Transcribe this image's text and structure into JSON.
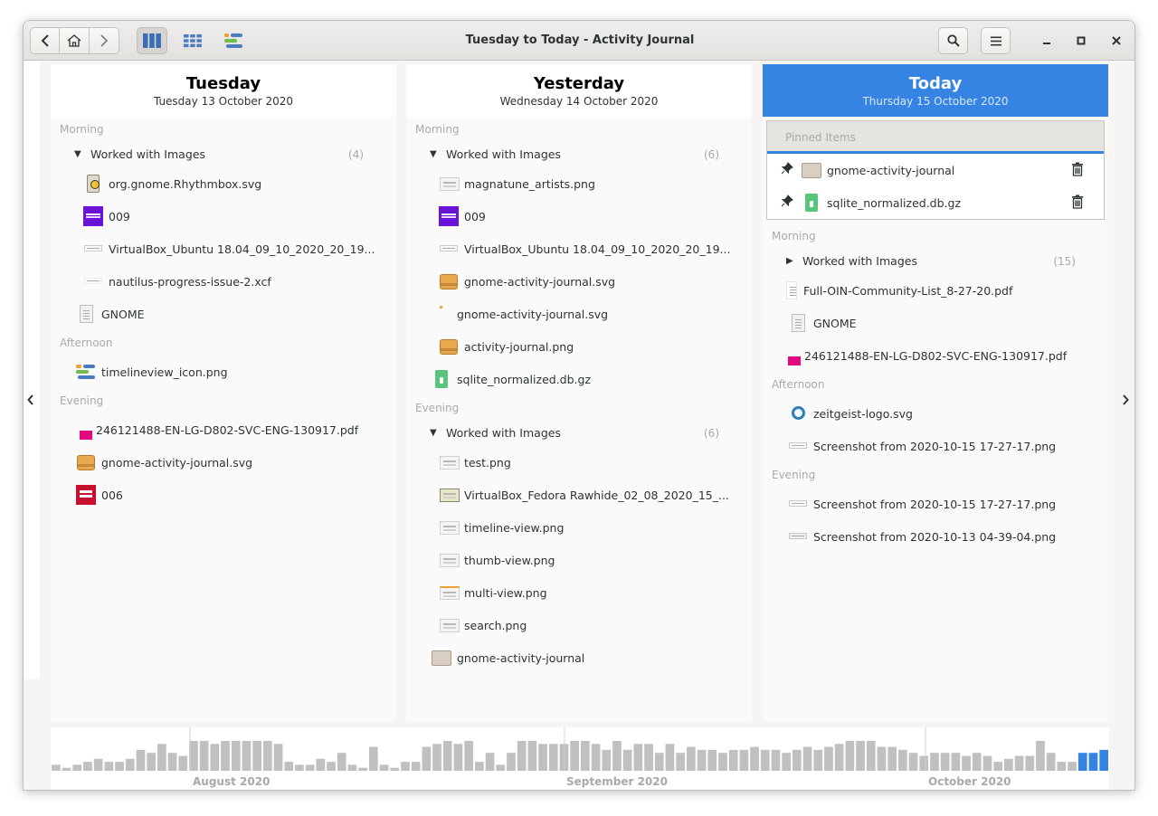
{
  "window": {
    "title": "Tuesday to Today - Activity Journal",
    "controls": {
      "minimize": "–",
      "maximize": "□",
      "close": "✕"
    }
  },
  "toolbar": {
    "back_icon": "chevron-left-icon",
    "home_icon": "home-icon",
    "forward_icon": "chevron-right-icon",
    "search_icon": "search-icon",
    "menu_icon": "hamburger-menu-icon",
    "accent": "#3584e4"
  },
  "columns": [
    {
      "day": "Tuesday",
      "date": "Tuesday 13 October 2020",
      "sections": [
        {
          "label": "Morning",
          "group": {
            "label": "Worked with Images",
            "count": "(4)"
          },
          "items": [
            {
              "label": "org.gnome.Rhythmbox.svg",
              "icon": "rhythmbox-icon"
            },
            {
              "label": "009",
              "icon": "purple-thumbnail-icon"
            },
            {
              "label": "VirtualBox_Ubuntu 18.04_09_10_2020_20_19...",
              "icon": "screenshot-icon"
            },
            {
              "label": "nautilus-progress-issue-2.xcf",
              "icon": "xcf-icon"
            }
          ],
          "after": [
            {
              "label": "GNOME",
              "icon": "document-icon"
            }
          ]
        },
        {
          "label": "Afternoon",
          "items": [
            {
              "label": "timelineview_icon.png",
              "icon": "timeline-icon"
            }
          ]
        },
        {
          "label": "Evening",
          "items": [
            {
              "label": "246121488-EN-LG-D802-SVC-ENG-130917.pdf",
              "icon": "pdf-icon"
            },
            {
              "label": "gnome-activity-journal.svg",
              "icon": "package-icon"
            },
            {
              "label": "006",
              "icon": "red-thumbnail-icon"
            }
          ]
        }
      ]
    },
    {
      "day": "Yesterday",
      "date": "Wednesday 14 October 2020",
      "sections": [
        {
          "label": "Morning",
          "group": {
            "label": "Worked with Images",
            "count": "(6)"
          },
          "items": [
            {
              "label": "magnatune_artists.png",
              "icon": "screenshot-icon"
            },
            {
              "label": "009",
              "icon": "purple-thumbnail-icon"
            },
            {
              "label": "VirtualBox_Ubuntu 18.04_09_10_2020_20_19...",
              "icon": "screenshot-icon"
            },
            {
              "label": "gnome-activity-journal.svg",
              "icon": "package-icon"
            },
            {
              "label": "gnome-activity-journal.svg",
              "icon": "small-dot-icon"
            },
            {
              "label": "activity-journal.png",
              "icon": "package-icon"
            }
          ],
          "after": [
            {
              "label": "sqlite_normalized.db.gz",
              "icon": "archive-icon"
            }
          ]
        },
        {
          "label": "Evening",
          "group": {
            "label": "Worked with Images",
            "count": "(6)"
          },
          "items": [
            {
              "label": "test.png",
              "icon": "screenshot-icon"
            },
            {
              "label": "VirtualBox_Fedora Rawhide_02_08_2020_15_...",
              "icon": "screenshot-icon"
            },
            {
              "label": "timeline-view.png",
              "icon": "screenshot-icon"
            },
            {
              "label": "thumb-view.png",
              "icon": "screenshot-icon"
            },
            {
              "label": "multi-view.png",
              "icon": "screenshot-icon"
            },
            {
              "label": "search.png",
              "icon": "screenshot-icon"
            }
          ],
          "after": [
            {
              "label": "gnome-activity-journal",
              "icon": "folder-icon"
            }
          ]
        }
      ]
    },
    {
      "day": "Today",
      "date": "Thursday 15 October 2020",
      "pinned": {
        "label": "Pinned Items",
        "items": [
          {
            "label": "gnome-activity-journal",
            "icon": "folder-icon"
          },
          {
            "label": "sqlite_normalized.db.gz",
            "icon": "archive-icon"
          }
        ]
      },
      "sections": [
        {
          "label": "Morning",
          "group": {
            "label": "Worked with Images",
            "count": "(15)",
            "collapsed": true
          },
          "items": [],
          "after": [
            {
              "label": "Full-OIN-Community-List_8-27-20.pdf",
              "icon": "pdf-doc-icon"
            },
            {
              "label": "GNOME",
              "icon": "document-icon"
            },
            {
              "label": "246121488-EN-LG-D802-SVC-ENG-130917.pdf",
              "icon": "pdf-icon"
            }
          ]
        },
        {
          "label": "Afternoon",
          "items": [
            {
              "label": "zeitgeist-logo.svg",
              "icon": "zeitgeist-icon"
            },
            {
              "label": "Screenshot from 2020-10-15 17-27-17.png",
              "icon": "screenshot-icon"
            }
          ]
        },
        {
          "label": "Evening",
          "items": [
            {
              "label": "Screenshot from 2020-10-15 17-27-17.png",
              "icon": "screenshot-icon"
            },
            {
              "label": "Screenshot from 2020-10-13 04-39-04.png",
              "icon": "screenshot-icon"
            }
          ]
        }
      ]
    }
  ],
  "timeline": {
    "months": [
      "August 2020",
      "September 2020",
      "October 2020"
    ],
    "bar_color": "#c0c0c0",
    "selected_color": "#3584e4",
    "activity": [
      2,
      1,
      2,
      3,
      4,
      3,
      3,
      4,
      7,
      6,
      9,
      6,
      5,
      10,
      10,
      9,
      10,
      10,
      10,
      10,
      10,
      9,
      3,
      2,
      2,
      4,
      3,
      6,
      2,
      1,
      8,
      2,
      1,
      3,
      3,
      8,
      9,
      10,
      9,
      10,
      3,
      6,
      2,
      6,
      10,
      10,
      9,
      9,
      9,
      10,
      10,
      9,
      7,
      10,
      7,
      9,
      9,
      6,
      9,
      6,
      8,
      7,
      7,
      6,
      7,
      7,
      8,
      7,
      7,
      6,
      7,
      8,
      7,
      8,
      9,
      10,
      10,
      10,
      8,
      8,
      7,
      6,
      5,
      6,
      6,
      6,
      5,
      6,
      5,
      3,
      4,
      5,
      5,
      10,
      6,
      3,
      3,
      6,
      6,
      7
    ],
    "selected_days": 3
  }
}
